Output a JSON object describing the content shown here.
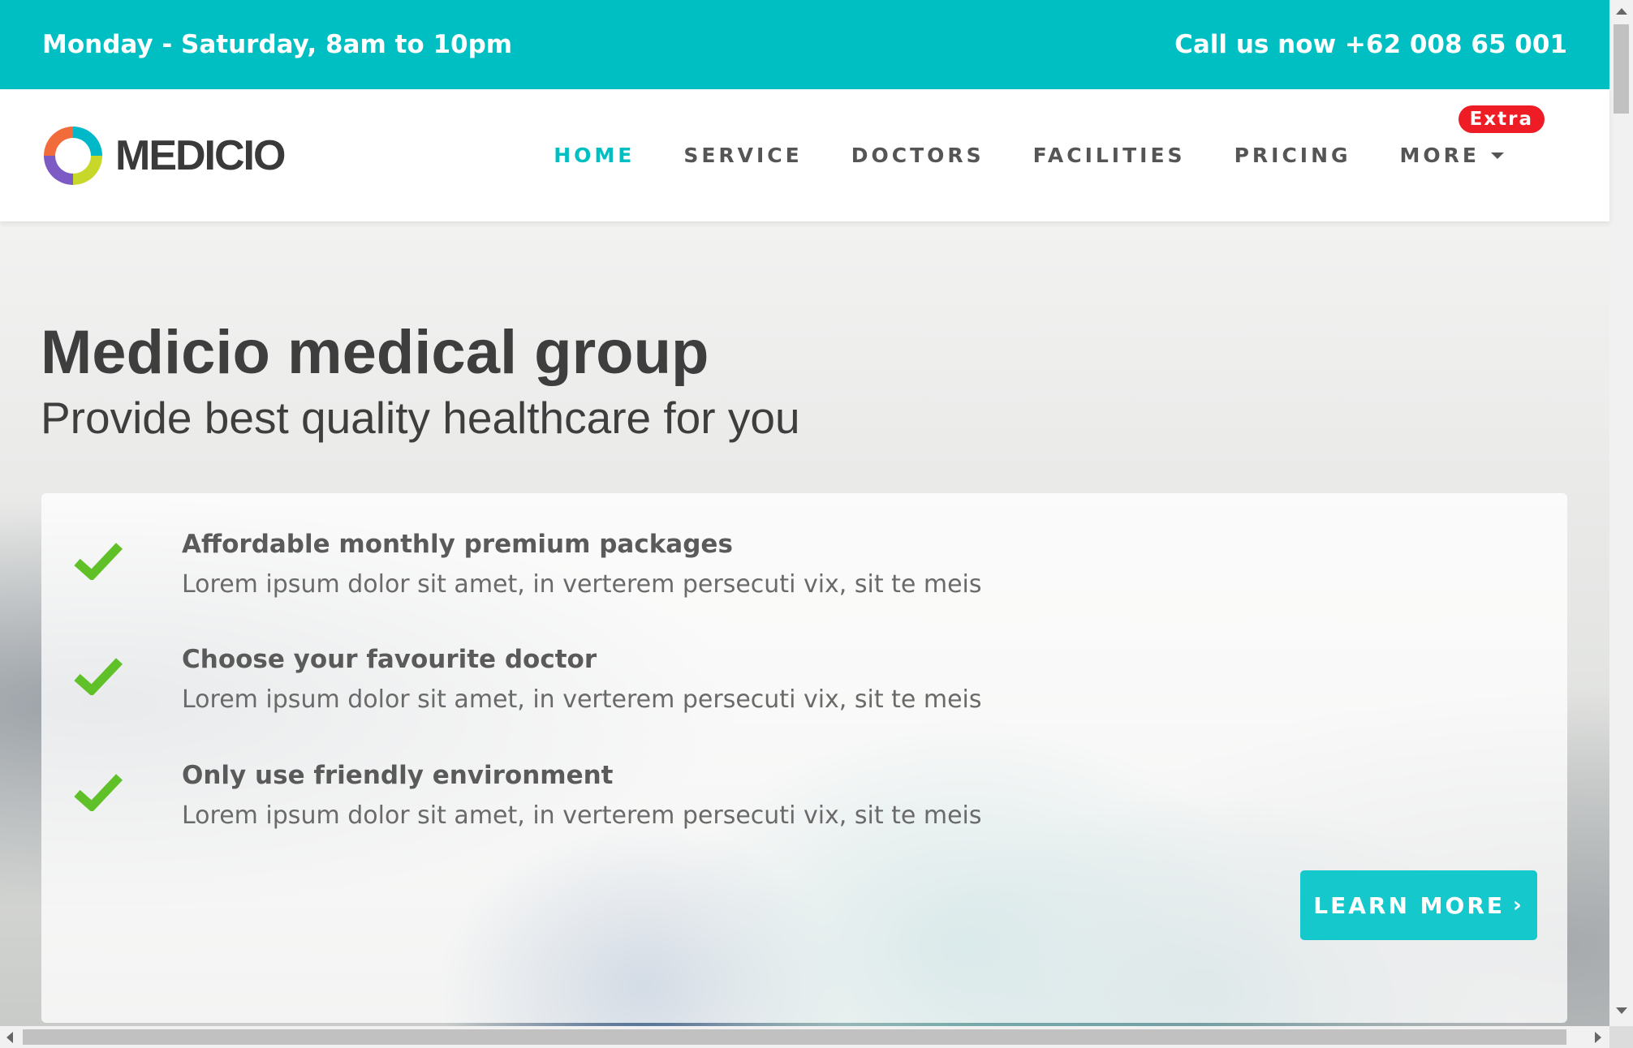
{
  "topbar": {
    "hours": "Monday - Saturday, 8am to 10pm",
    "phone": "Call us now +62 008 65 001"
  },
  "header": {
    "logo_text": "MEDICIO",
    "nav": [
      {
        "label": "HOME"
      },
      {
        "label": "SERVICE"
      },
      {
        "label": "DOCTORS"
      },
      {
        "label": "FACILITIES"
      },
      {
        "label": "PRICING"
      },
      {
        "label": "MORE"
      }
    ],
    "badge": "Extra"
  },
  "hero": {
    "title": "Medicio medical group",
    "subtitle": "Provide best quality healthcare for you",
    "features": [
      {
        "title": "Affordable monthly premium packages",
        "desc": "Lorem ipsum dolor sit amet, in verterem persecuti vix, sit te meis"
      },
      {
        "title": "Choose your favourite doctor",
        "desc": "Lorem ipsum dolor sit amet, in verterem persecuti vix, sit te meis"
      },
      {
        "title": "Only use friendly environment",
        "desc": "Lorem ipsum dolor sit amet, in verterem persecuti vix, sit te meis"
      }
    ],
    "button_label": "LEARN MORE",
    "button_icon": "chevron-right-icon"
  },
  "colors": {
    "accent": "#00bfc2",
    "check": "#5fc127",
    "badge": "#ee1c25"
  }
}
